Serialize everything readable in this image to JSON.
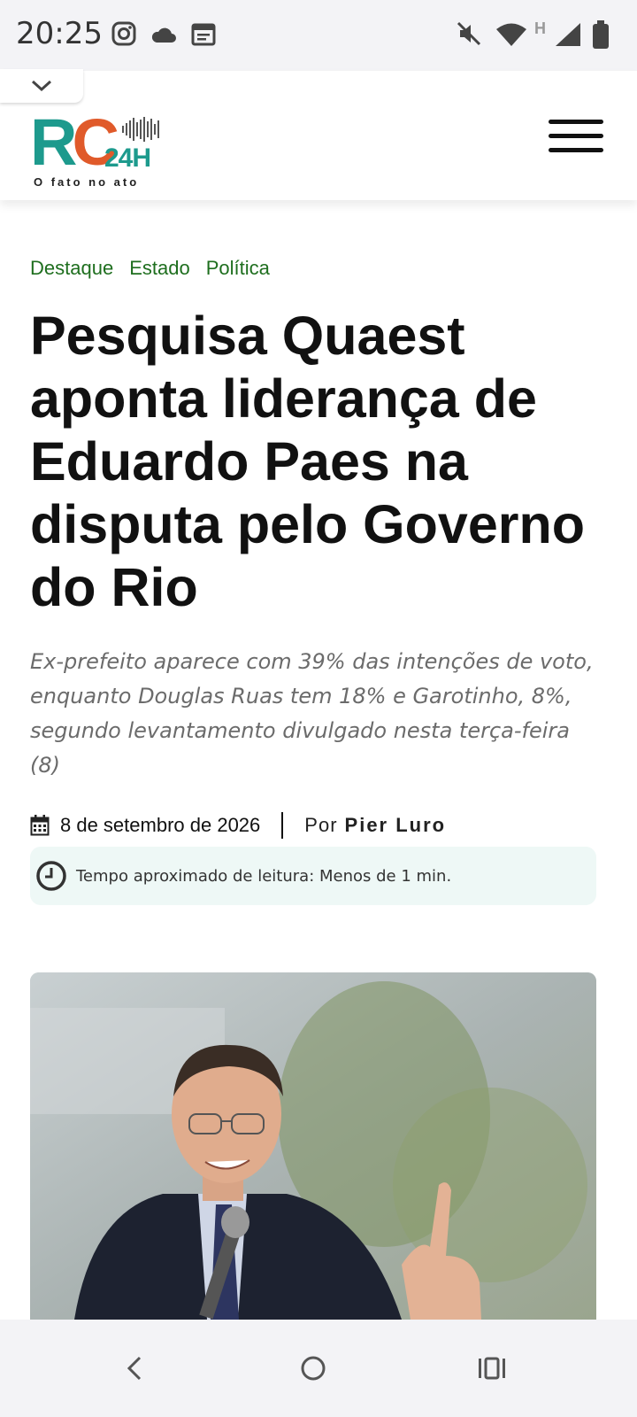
{
  "status_bar": {
    "time": "20:25",
    "left_icons": [
      "instagram-icon",
      "cloud-icon",
      "calendar-icon"
    ],
    "right_icons": [
      "mute-icon",
      "wifi-icon",
      "network-h-icon",
      "signal-icon",
      "battery-icon"
    ],
    "network_label": "H"
  },
  "header": {
    "logo_main": "RC",
    "logo_sub": "24H",
    "logo_tagline": "O fato no ato",
    "colors": {
      "teal": "#1d9a8d",
      "orange": "#e05a2a"
    }
  },
  "article": {
    "categories": [
      "Destaque",
      "Estado",
      "Política"
    ],
    "headline": "Pesquisa Quaest aponta liderança de Eduardo Paes na disputa pelo Governo do Rio",
    "subtitle": "Ex-prefeito aparece com 39% das intenções de voto, enquanto Douglas Ruas tem 18% e Garotinho, 8%, segundo levantamento divulgado nesta terça-feira (8)",
    "date": "8 de setembro de 2026",
    "by_label": "Por",
    "author": "Pier Luro",
    "reading_time": "Tempo aproximado de leitura: Menos de 1 min."
  },
  "nav_bar": {
    "buttons": [
      "back-icon",
      "home-icon",
      "recents-icon"
    ]
  }
}
